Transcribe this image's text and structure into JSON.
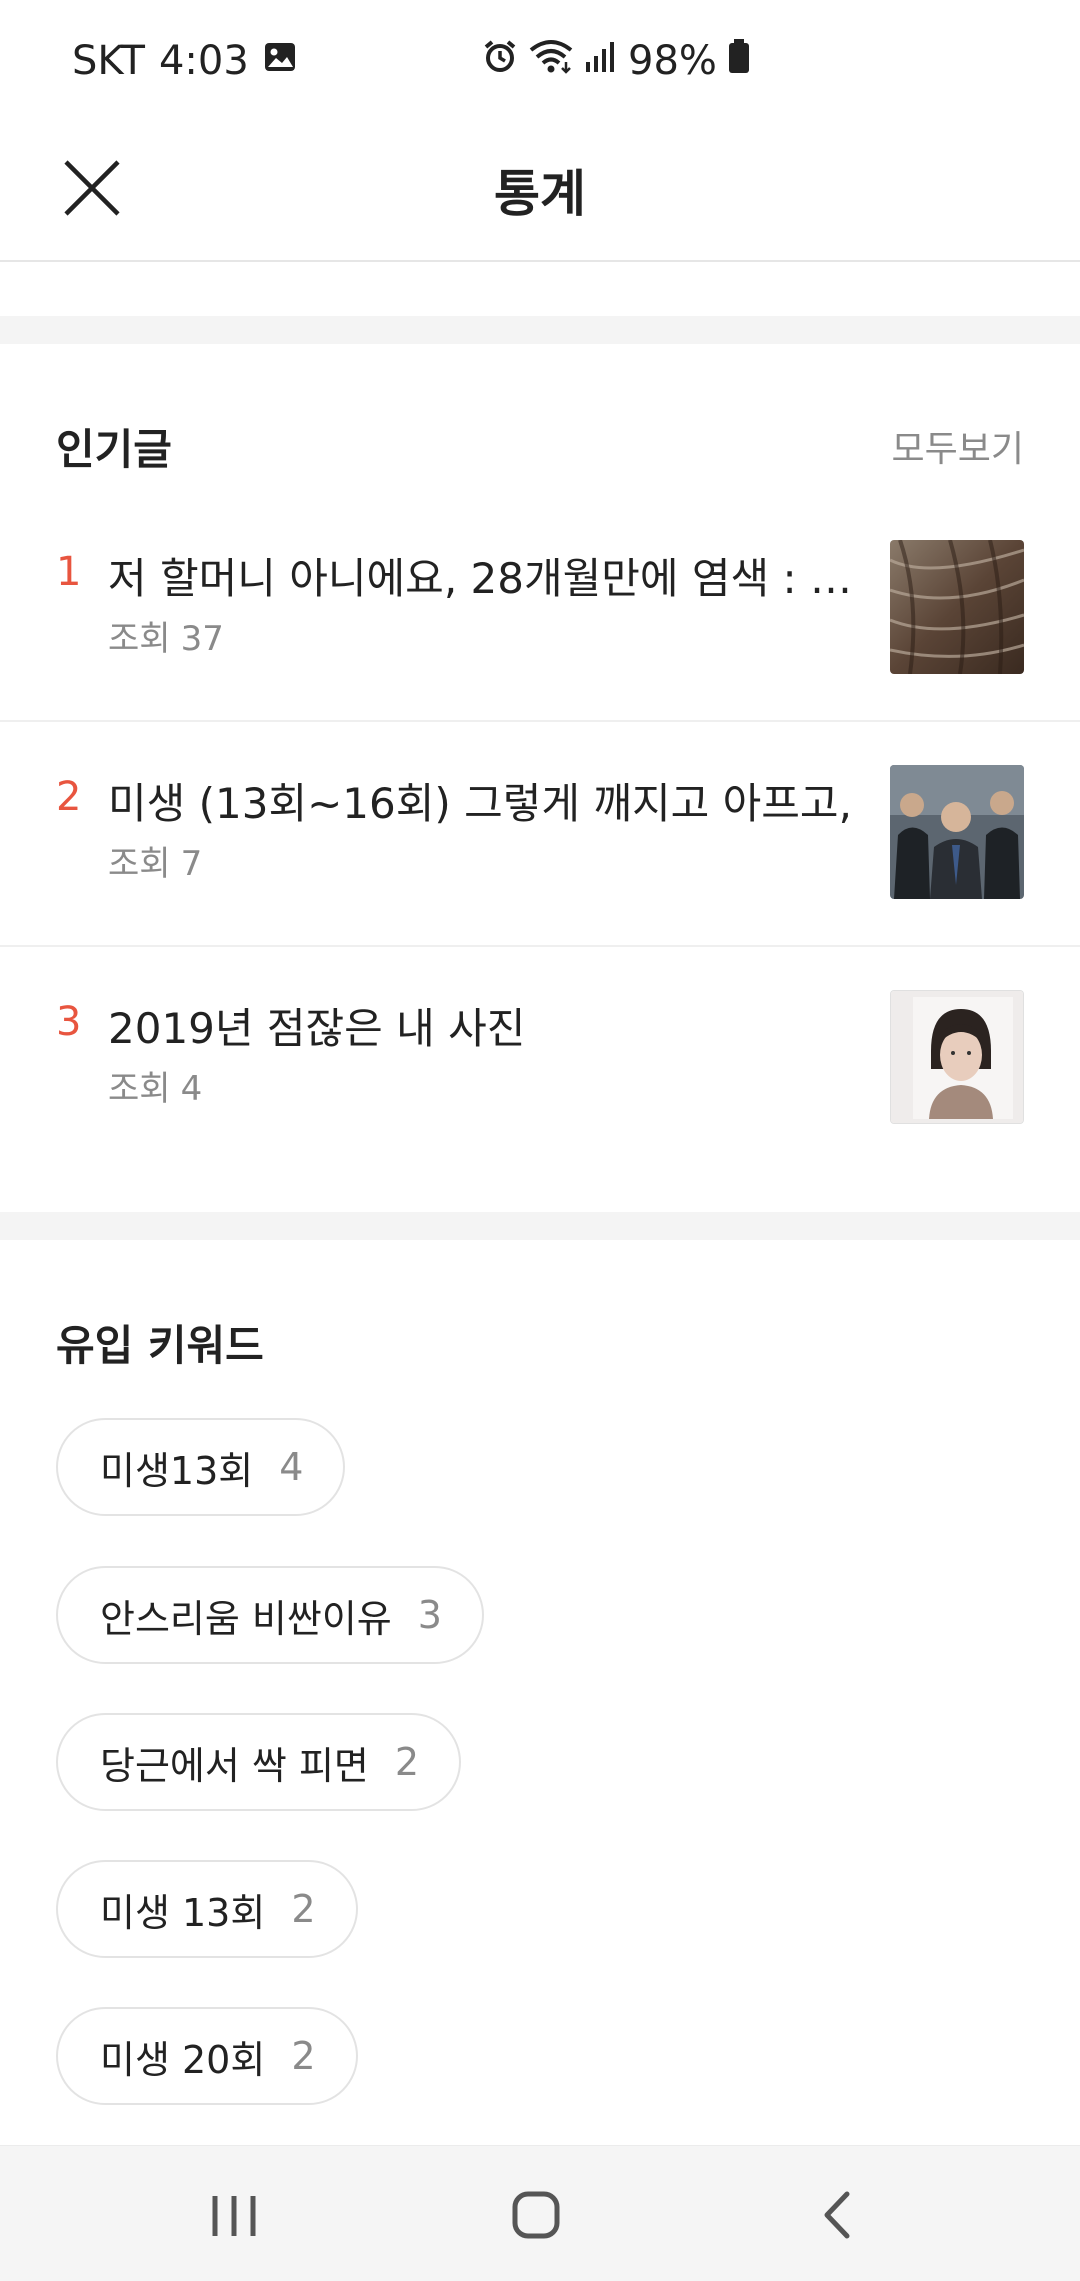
{
  "status_bar": {
    "carrier": "SKT",
    "time": "4:03",
    "battery": "98%"
  },
  "header": {
    "title": "통계",
    "close_icon": "close-icon"
  },
  "popular_posts": {
    "title": "인기글",
    "see_all": "모두보기",
    "items": [
      {
        "rank": "1",
        "title": "저 할머니 아니에요, 28개월만에 염색 : …",
        "views_label": "조회",
        "views": "37"
      },
      {
        "rank": "2",
        "title": "미생 (13회~16회) 그렇게 깨지고 아프고, …",
        "views_label": "조회",
        "views": "7"
      },
      {
        "rank": "3",
        "title": "2019년 점잖은 내 사진",
        "views_label": "조회",
        "views": "4"
      }
    ]
  },
  "inflow_keywords": {
    "title": "유입 키워드",
    "items": [
      {
        "keyword": "미생13회",
        "count": "4"
      },
      {
        "keyword": "안스리움 비싼이유",
        "count": "3"
      },
      {
        "keyword": "당근에서 싹 피면",
        "count": "2"
      },
      {
        "keyword": "미생 13회",
        "count": "2"
      },
      {
        "keyword": "미생 20회",
        "count": "2"
      }
    ]
  },
  "colors": {
    "rank_accent": "#e8553f",
    "muted_text": "#8a8a8a",
    "section_gap": "#f4f4f4"
  },
  "nav_bar": {
    "icons": [
      "recent-apps-icon",
      "home-icon",
      "back-icon"
    ]
  }
}
